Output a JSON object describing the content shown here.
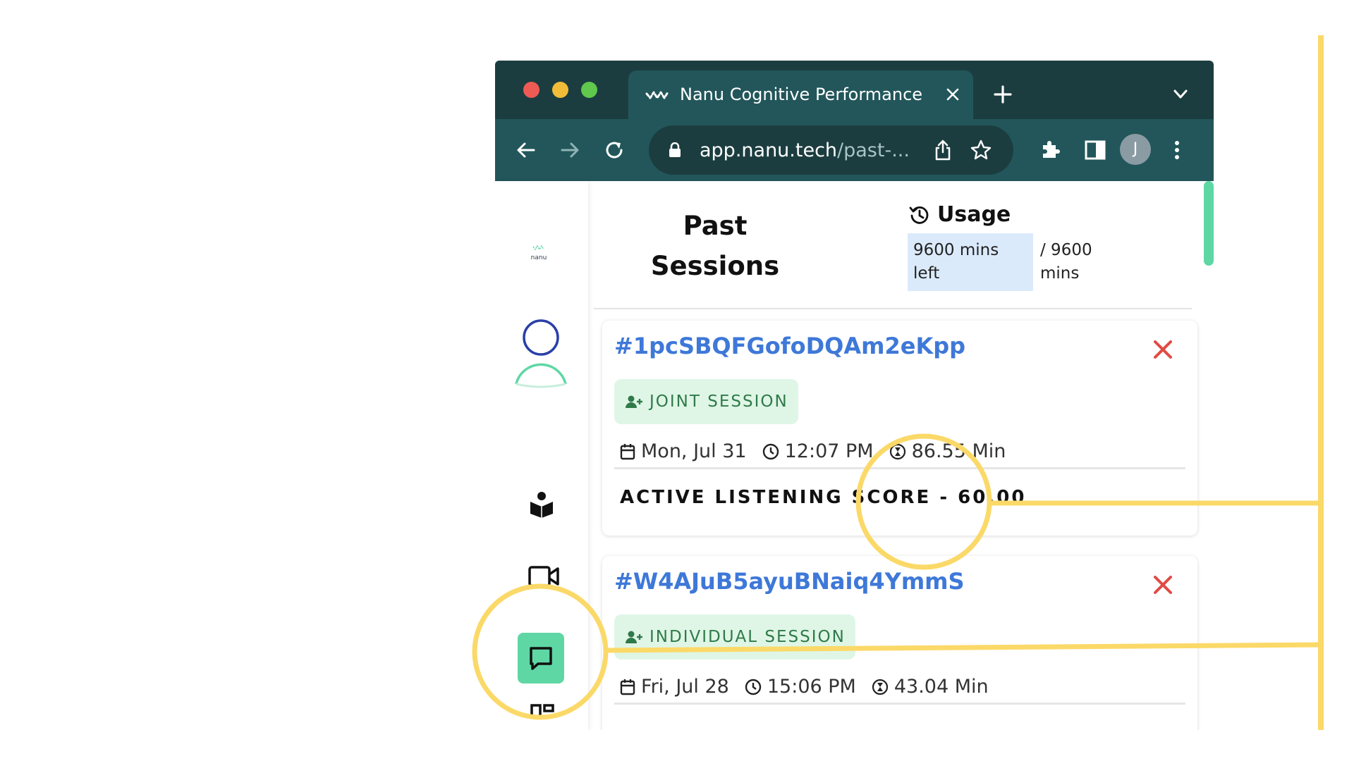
{
  "browser": {
    "tab_title": "Nanu Cognitive Performance",
    "url_host": "app.nanu.tech",
    "url_rest": "/past-...",
    "profile_initial": "J"
  },
  "sidebar": {
    "logo_text": "nanu",
    "items": [
      {
        "icon": "user-avatar-icon"
      },
      {
        "icon": "book-reader-icon"
      },
      {
        "icon": "video-camera-icon"
      },
      {
        "icon": "chat-bubble-icon",
        "active": true
      },
      {
        "icon": "grid-icon"
      }
    ]
  },
  "header": {
    "title_line1": "Past",
    "title_line2": "Sessions",
    "usage_label": "Usage",
    "usage_left": "9600 mins left",
    "usage_total": "/ 9600 mins"
  },
  "sessions": [
    {
      "id": "#1pcSBQFGofoDQAm2eKpp",
      "type": "JOINT SESSION",
      "date": "Mon, Jul 31",
      "time": "12:07 PM",
      "duration": "86.55 Min",
      "score": "ACTIVE LISTENING SCORE - 60.00"
    },
    {
      "id": "#W4AJuB5ayuBNaiq4YmmS",
      "type": "INDIVIDUAL SESSION",
      "date": "Fri, Jul 28",
      "time": "15:06 PM",
      "duration": "43.04 Min"
    }
  ],
  "colors": {
    "accent_green": "#5ed7a4",
    "link_blue": "#3e78d8",
    "delete_red": "#e04b43",
    "annotation_yellow": "#fbd968",
    "chrome_dark": "#1c3d40",
    "chrome_tab": "#22565a"
  }
}
